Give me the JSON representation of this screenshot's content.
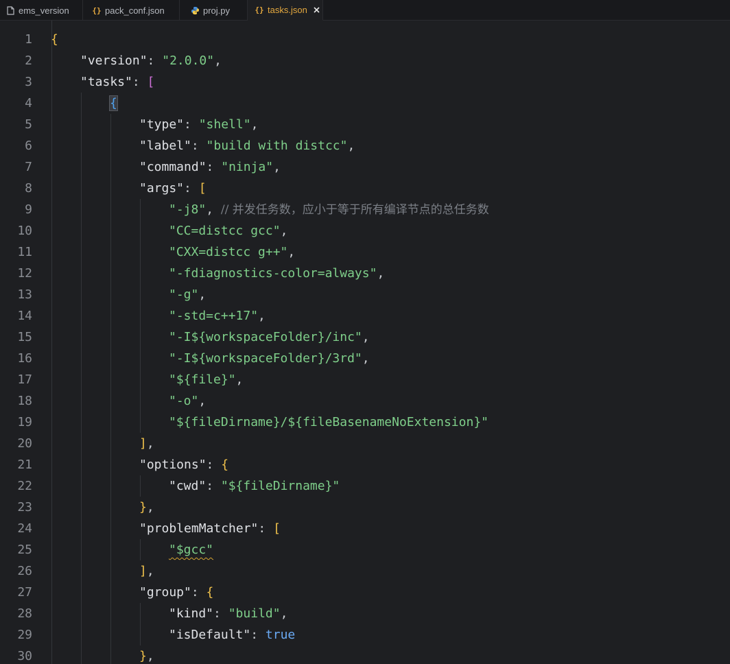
{
  "tabs": [
    {
      "label": "ems_version",
      "icon": "file-icon",
      "active": false
    },
    {
      "label": "pack_conf.json",
      "icon": "json-braces-icon",
      "active": false
    },
    {
      "label": "proj.py",
      "icon": "python-icon",
      "active": false
    },
    {
      "label": "tasks.json",
      "icon": "json-braces-icon",
      "active": true
    }
  ],
  "active_tab_close": "close-icon",
  "editor": {
    "comment": "// 并发任务数，应小于等于所有编译节点的总任务数",
    "lines": [
      {
        "n": "1"
      },
      {
        "n": "2"
      },
      {
        "n": "3"
      },
      {
        "n": "4"
      },
      {
        "n": "5"
      },
      {
        "n": "6"
      },
      {
        "n": "7"
      },
      {
        "n": "8"
      },
      {
        "n": "9"
      },
      {
        "n": "10"
      },
      {
        "n": "11"
      },
      {
        "n": "12"
      },
      {
        "n": "13"
      },
      {
        "n": "14"
      },
      {
        "n": "15"
      },
      {
        "n": "16"
      },
      {
        "n": "17"
      },
      {
        "n": "18"
      },
      {
        "n": "19"
      },
      {
        "n": "20"
      },
      {
        "n": "21"
      },
      {
        "n": "22"
      },
      {
        "n": "23"
      },
      {
        "n": "24"
      },
      {
        "n": "25"
      },
      {
        "n": "26"
      },
      {
        "n": "27"
      },
      {
        "n": "28"
      },
      {
        "n": "29"
      },
      {
        "n": "30"
      }
    ],
    "tokens": {
      "l1_open": "{",
      "l2_key": "\"version\"",
      "l2_colon": ": ",
      "l2_val": "\"2.0.0\"",
      "l2_comma": ",",
      "l3_key": "\"tasks\"",
      "l3_colon": ": ",
      "l3_open": "[",
      "l4_open": "{",
      "l5_key": "\"type\"",
      "l5_colon": ": ",
      "l5_val": "\"shell\"",
      "l5_comma": ",",
      "l6_key": "\"label\"",
      "l6_colon": ": ",
      "l6_val": "\"build with distcc\"",
      "l6_comma": ",",
      "l7_key": "\"command\"",
      "l7_colon": ": ",
      "l7_val": "\"ninja\"",
      "l7_comma": ",",
      "l8_key": "\"args\"",
      "l8_colon": ": ",
      "l8_open": "[",
      "l9_val": "\"-j8\"",
      "l9_comma": ", ",
      "l10_val": "\"CC=distcc gcc\"",
      "l10_comma": ",",
      "l11_val": "\"CXX=distcc g++\"",
      "l11_comma": ",",
      "l12_val": "\"-fdiagnostics-color=always\"",
      "l12_comma": ",",
      "l13_val": "\"-g\"",
      "l13_comma": ",",
      "l14_val": "\"-std=c++17\"",
      "l14_comma": ",",
      "l15_val": "\"-I${workspaceFolder}/inc\"",
      "l15_comma": ",",
      "l16_val": "\"-I${workspaceFolder}/3rd\"",
      "l16_comma": ",",
      "l17_val": "\"${file}\"",
      "l17_comma": ",",
      "l18_val": "\"-o\"",
      "l18_comma": ",",
      "l19_val": "\"${fileDirname}/${fileBasenameNoExtension}\"",
      "l20_close": "]",
      "l20_comma": ",",
      "l21_key": "\"options\"",
      "l21_colon": ": ",
      "l21_open": "{",
      "l22_key": "\"cwd\"",
      "l22_colon": ": ",
      "l22_val": "\"${fileDirname}\"",
      "l23_close": "}",
      "l23_comma": ",",
      "l24_key": "\"problemMatcher\"",
      "l24_colon": ": ",
      "l24_open": "[",
      "l25_val": "\"$gcc\"",
      "l26_close": "]",
      "l26_comma": ",",
      "l27_key": "\"group\"",
      "l27_colon": ": ",
      "l27_open": "{",
      "l28_key": "\"kind\"",
      "l28_colon": ": ",
      "l28_val": "\"build\"",
      "l28_comma": ",",
      "l29_key": "\"isDefault\"",
      "l29_colon": ": ",
      "l29_val": "true",
      "l30_close": "}",
      "l30_comma": ","
    }
  },
  "colors": {
    "background": "#1e1f22",
    "string": "#7fcf8a",
    "key": "#dfe1e5",
    "bracket_level1": "#f0c14b",
    "bracket_level2": "#cc6fd6",
    "bracket_level3": "#4fa3f0",
    "comment": "#7b7f86",
    "keyword": "#6aaaf4",
    "active_tab_text": "#e5a93f"
  }
}
